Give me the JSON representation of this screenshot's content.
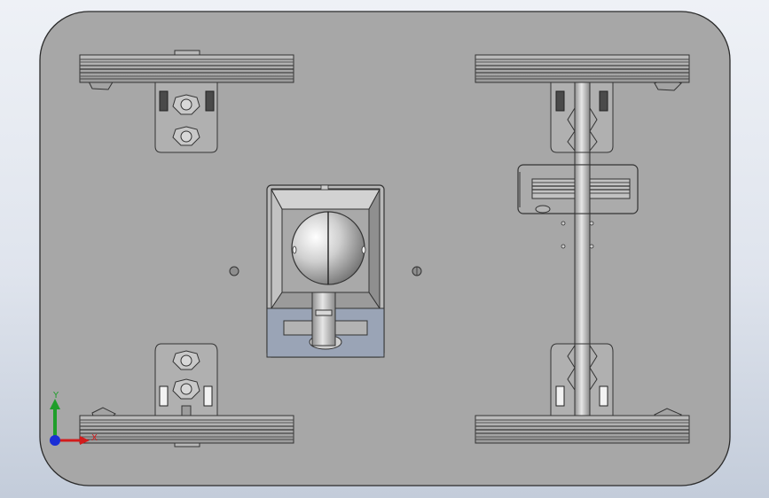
{
  "viewport": {
    "view": "cad-model-viewport",
    "background_colors": [
      "#eef1f6",
      "#dfe4ed",
      "#c3ccda"
    ]
  },
  "model": {
    "plate_color": "#a7a7a7",
    "wheels": 4,
    "ball_caster": 1,
    "axle_with_pulley": 1,
    "motor_mounts": 4
  },
  "triad": {
    "y_label": "Y",
    "x_label": "X",
    "y_color": "#1f9e2a",
    "x_color": "#d21c1c",
    "z_color": "#1b2fd6"
  }
}
